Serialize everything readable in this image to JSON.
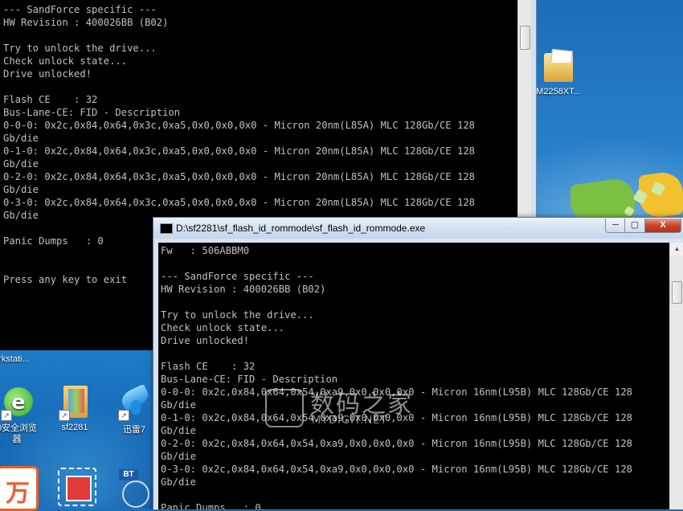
{
  "desktop": {
    "icons": [
      {
        "label": "M2258XT..."
      },
      {
        "label": "orkstati..."
      },
      {
        "label": "0安全浏览\n器"
      },
      {
        "label": "sf2281"
      },
      {
        "label": "迅雷7"
      }
    ]
  },
  "back_console": {
    "lines": [
      "--- SandForce specific ---",
      "HW Revision : 400026BB (B02)",
      "",
      "Try to unlock the drive...",
      "Check unlock state...",
      "Drive unlocked!",
      "",
      "Flash CE    : 32",
      "Bus-Lane-CE: FID - Description",
      "0-0-0: 0x2c,0x84,0x64,0x3c,0xa5,0x0,0x0,0x0 - Micron 20nm(L85A) MLC 128Gb/CE 128",
      "Gb/die",
      "0-1-0: 0x2c,0x84,0x64,0x3c,0xa5,0x0,0x0,0x0 - Micron 20nm(L85A) MLC 128Gb/CE 128",
      "Gb/die",
      "0-2-0: 0x2c,0x84,0x64,0x3c,0xa5,0x0,0x0,0x0 - Micron 20nm(L85A) MLC 128Gb/CE 128",
      "Gb/die",
      "0-3-0: 0x2c,0x84,0x64,0x3c,0xa5,0x0,0x0,0x0 - Micron 20nm(L85A) MLC 128Gb/CE 128",
      "Gb/die",
      "",
      "Panic Dumps   : 0",
      "",
      "",
      "Press any key to exit"
    ]
  },
  "front_window": {
    "title": "D:\\sf2281\\sf_flash_id_rommode\\sf_flash_id_rommode.exe",
    "controls": {
      "minimize": "─",
      "maximize": "▢",
      "close": "X"
    },
    "lines": [
      "Fw   : 506ABBM0",
      "",
      "--- SandForce specific ---",
      "HW Revision : 400026BB (B02)",
      "",
      "Try to unlock the drive...",
      "Check unlock state...",
      "Drive unlocked!",
      "",
      "Flash CE    : 32",
      "Bus-Lane-CE: FID - Description",
      "0-0-0: 0x2c,0x84,0x64,0x54,0xa9,0x0,0x0,0x0 - Micron 16nm(L95B) MLC 128Gb/CE 128",
      "Gb/die",
      "0-1-0: 0x2c,0x84,0x64,0x54,0xa9,0x0,0x0,0x0 - Micron 16nm(L95B) MLC 128Gb/CE 128",
      "Gb/die",
      "0-2-0: 0x2c,0x84,0x64,0x54,0xa9,0x0,0x0,0x0 - Micron 16nm(L95B) MLC 128Gb/CE 128",
      "Gb/die",
      "0-3-0: 0x2c,0x84,0x64,0x54,0xa9,0x0,0x0,0x0 - Micron 16nm(L95B) MLC 128Gb/CE 128",
      "Gb/die",
      "",
      "Panic Dumps   : 0"
    ]
  },
  "watermark": {
    "main": "数码之家",
    "site": "MYDIGIT.NET"
  },
  "icons": {
    "back_tray_icon": "BT"
  }
}
